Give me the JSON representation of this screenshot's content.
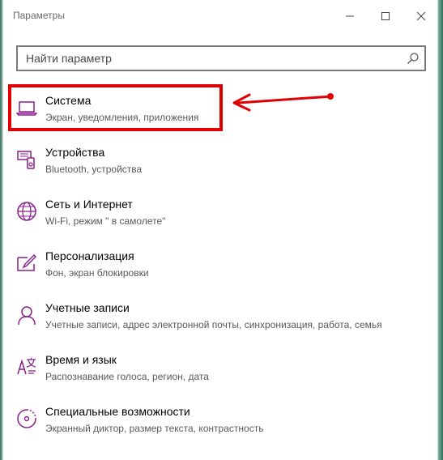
{
  "window": {
    "title": "Параметры"
  },
  "search": {
    "placeholder": "Найти параметр"
  },
  "items": [
    {
      "label": "Система",
      "desc": "Экран, уведомления, приложения",
      "icon": "laptop-icon"
    },
    {
      "label": "Устройства",
      "desc": "Bluetooth, устройства",
      "icon": "devices-icon"
    },
    {
      "label": "Сеть и Интернет",
      "desc": "Wi-Fi, режим \" в самолете\"",
      "icon": "globe-icon"
    },
    {
      "label": "Персонализация",
      "desc": "Фон, экран блокировки",
      "icon": "paintbrush-icon"
    },
    {
      "label": "Учетные записи",
      "desc": "Учетные записи, адрес электронной почты, синхронизация, работа, семья",
      "icon": "person-icon"
    },
    {
      "label": "Время и язык",
      "desc": "Распознавание голоса, регион, дата",
      "icon": "time-language-icon"
    },
    {
      "label": "Специальные возможности",
      "desc": "Экранный диктор, размер текста, контрастность",
      "icon": "ease-of-access-icon"
    }
  ],
  "colors": {
    "accent": "#8a1c8e",
    "highlight": "#e00000"
  }
}
